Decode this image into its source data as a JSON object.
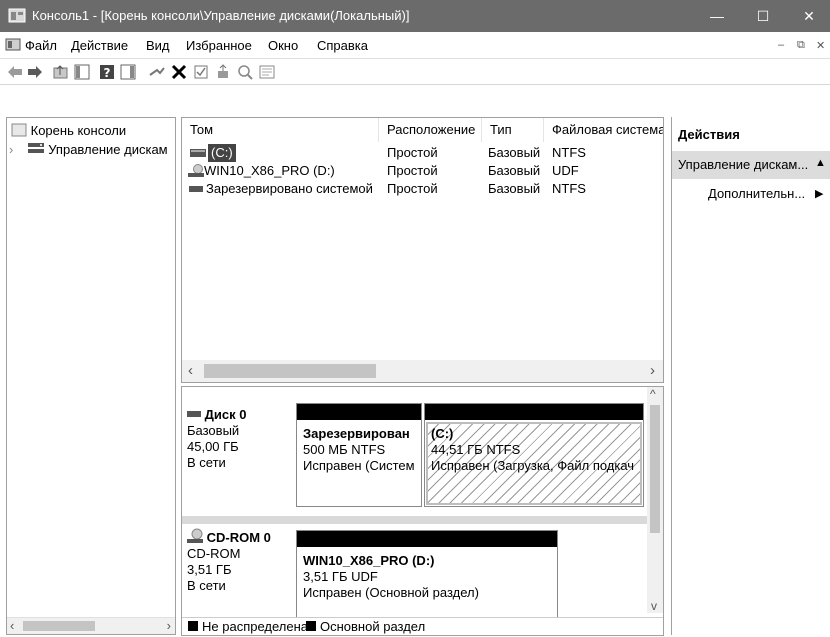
{
  "window": {
    "title": "Консоль1 - [Корень консоли\\Управление дисками(Локальный)]",
    "buttons": {
      "minimize": "—",
      "maximize": "☐",
      "close": "✕"
    }
  },
  "menu": {
    "items": [
      "Файл",
      "Действие",
      "Вид",
      "Избранное",
      "Окно",
      "Справка"
    ],
    "mdi_minimize": "–",
    "mdi_restore": "⧉",
    "mdi_close": "✕"
  },
  "toolbar": {
    "icons": [
      "back-icon",
      "forward-icon",
      "up-folder-icon",
      "show-hide-console-tree-icon",
      "help-icon",
      "action-pane-icon",
      "connect-icon",
      "delete-icon",
      "check-icon",
      "extend-icon",
      "search-icon",
      "properties-icon"
    ]
  },
  "tree": {
    "root": "Корень консоли",
    "child": "Управление дискам",
    "expand_glyph": "›"
  },
  "volumes": {
    "columns": [
      "Том",
      "Расположение",
      "Тип",
      "Файловая система"
    ],
    "rows": [
      {
        "name": "(C:)",
        "location": "Простой",
        "type": "Базовый",
        "fs": "NTFS"
      },
      {
        "name": "WIN10_X86_PRO (D:)",
        "location": "Простой",
        "type": "Базовый",
        "fs": "UDF"
      },
      {
        "name": "Зарезервировано системой",
        "location": "Простой",
        "type": "Базовый",
        "fs": "NTFS"
      }
    ]
  },
  "disks": [
    {
      "name": "Диск 0",
      "kind": "Базовый",
      "size": "45,00 ГБ",
      "status": "В сети",
      "partitions": [
        {
          "title": "Зарезервирован",
          "size_fs": "500 МБ NTFS",
          "health": "Исправен (Систем"
        },
        {
          "title": "(C:)",
          "size_fs": "44,51 ГБ NTFS",
          "health": "Исправен (Загрузка, Файл подкач"
        }
      ]
    },
    {
      "name": "CD-ROM 0",
      "kind": "CD-ROM",
      "size": "3,51 ГБ",
      "status": "В сети",
      "partitions": [
        {
          "title": "WIN10_X86_PRO  (D:)",
          "size_fs": "3,51 ГБ UDF",
          "health": "Исправен (Основной раздел)"
        }
      ]
    }
  ],
  "legend": {
    "unallocated": "Не распределена",
    "primary": "Основной раздел"
  },
  "actions": {
    "header": "Действия",
    "section": "Управление дискам...",
    "more": "Дополнительн...",
    "collapse_glyph": "▲",
    "submenu_glyph": "▶"
  },
  "scroll_glyphs": {
    "left": "‹",
    "right": "›",
    "up": "^",
    "down": "v"
  },
  "colors": {
    "titlebar": "#6b6b6b",
    "partition_bar": "#000000",
    "selection_band": "#bdbdbd"
  }
}
